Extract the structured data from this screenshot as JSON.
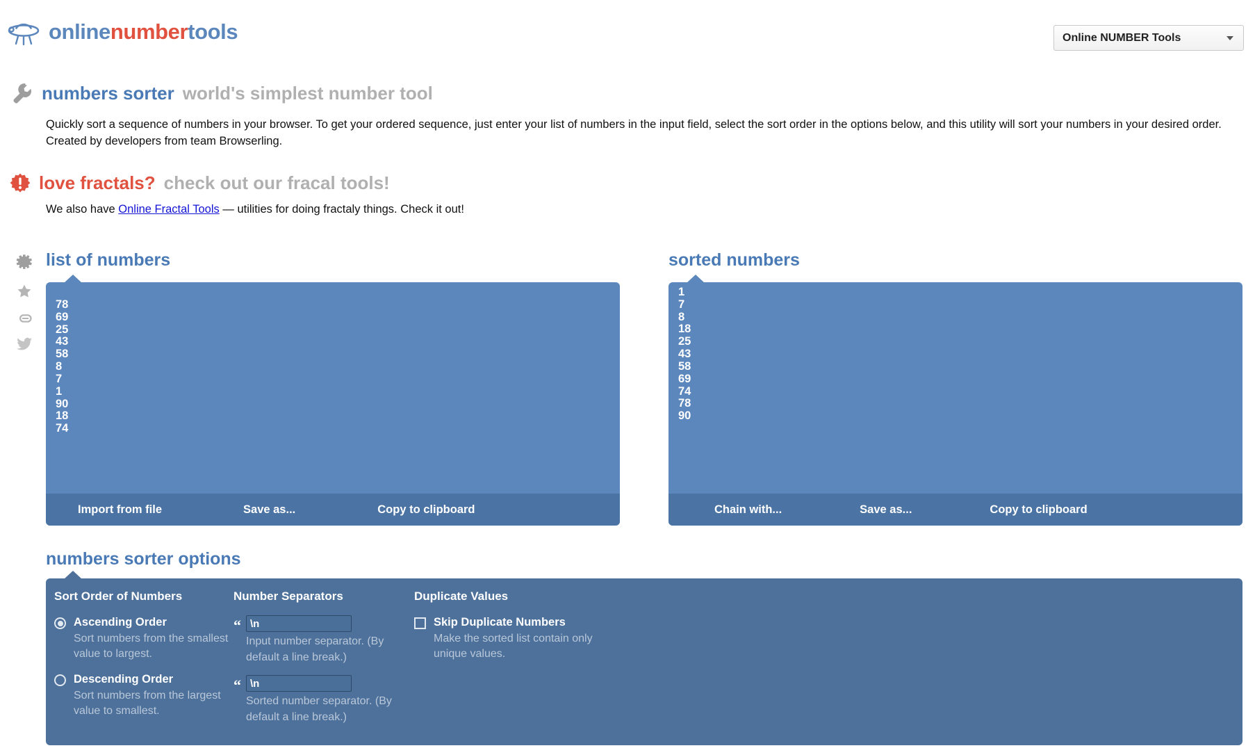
{
  "header": {
    "logo": {
      "icon": "ufo-icon",
      "part1": "online",
      "part2": "number",
      "part3": "tools",
      "color_blue": "#5b87bd",
      "color_red": "#e0523f"
    },
    "tool_select": {
      "value": "Online NUMBER Tools",
      "caret_icon": "chevron-down-icon"
    }
  },
  "tool": {
    "icon": "wrench-icon",
    "title": "numbers sorter",
    "subtitle": "world's simplest number tool",
    "description": "Quickly sort a sequence of numbers in your browser. To get your ordered sequence, just enter your list of numbers in the input field, select the sort order in the options below, and this utility will sort your numbers in your desired order. Created by developers from team Browserling."
  },
  "promo": {
    "icon": "alert-badge-icon",
    "title": "love fractals?",
    "subtitle": "check out our fracal tools!",
    "text_before": "We also have ",
    "link_text": "Online Fractal Tools",
    "text_after": " — utilities for doing fractaly things. Check it out!"
  },
  "sidebar": {
    "icons": [
      "gear-icon",
      "star-icon",
      "link-icon",
      "twitter-icon"
    ]
  },
  "input_panel": {
    "heading": "list of numbers",
    "value": "78\n69\n25\n43\n58\n8\n7\n1\n90\n18\n74",
    "numbers": [
      78,
      69,
      25,
      43,
      58,
      8,
      7,
      1,
      90,
      18,
      74
    ],
    "toolbar": {
      "import": "Import from file",
      "save": "Save as...",
      "copy": "Copy to clipboard"
    }
  },
  "output_panel": {
    "heading": "sorted numbers",
    "value": "1\n7\n8\n18\n25\n43\n58\n69\n74\n78\n90",
    "numbers": [
      1,
      7,
      8,
      18,
      25,
      43,
      58,
      69,
      74,
      78,
      90
    ],
    "toolbar": {
      "chain": "Chain with...",
      "save": "Save as...",
      "copy": "Copy to clipboard"
    }
  },
  "options": {
    "heading": "numbers sorter options",
    "sort_order": {
      "title": "Sort Order of Numbers",
      "ascending": {
        "label": "Ascending Order",
        "desc": "Sort numbers from the smallest value to largest.",
        "selected": true
      },
      "descending": {
        "label": "Descending Order",
        "desc": "Sort numbers from the largest value to smallest.",
        "selected": false
      }
    },
    "separators": {
      "title": "Number Separators",
      "input_sep": {
        "value": "\\n",
        "desc": "Input number separator. (By default a line break.)"
      },
      "output_sep": {
        "value": "\\n",
        "desc": "Sorted number separator. (By default a line break.)"
      }
    },
    "duplicates": {
      "title": "Duplicate Values",
      "skip": {
        "label": "Skip Duplicate Numbers",
        "desc": "Make the sorted list contain only unique values.",
        "checked": false
      }
    }
  },
  "colors": {
    "panel": "#5b87bd",
    "panel_toolbar": "#4b74a4",
    "options_panel": "#4d719b",
    "accent_blue": "#4a7ab5",
    "accent_red": "#e0523f",
    "muted": "#b0b0b0"
  }
}
